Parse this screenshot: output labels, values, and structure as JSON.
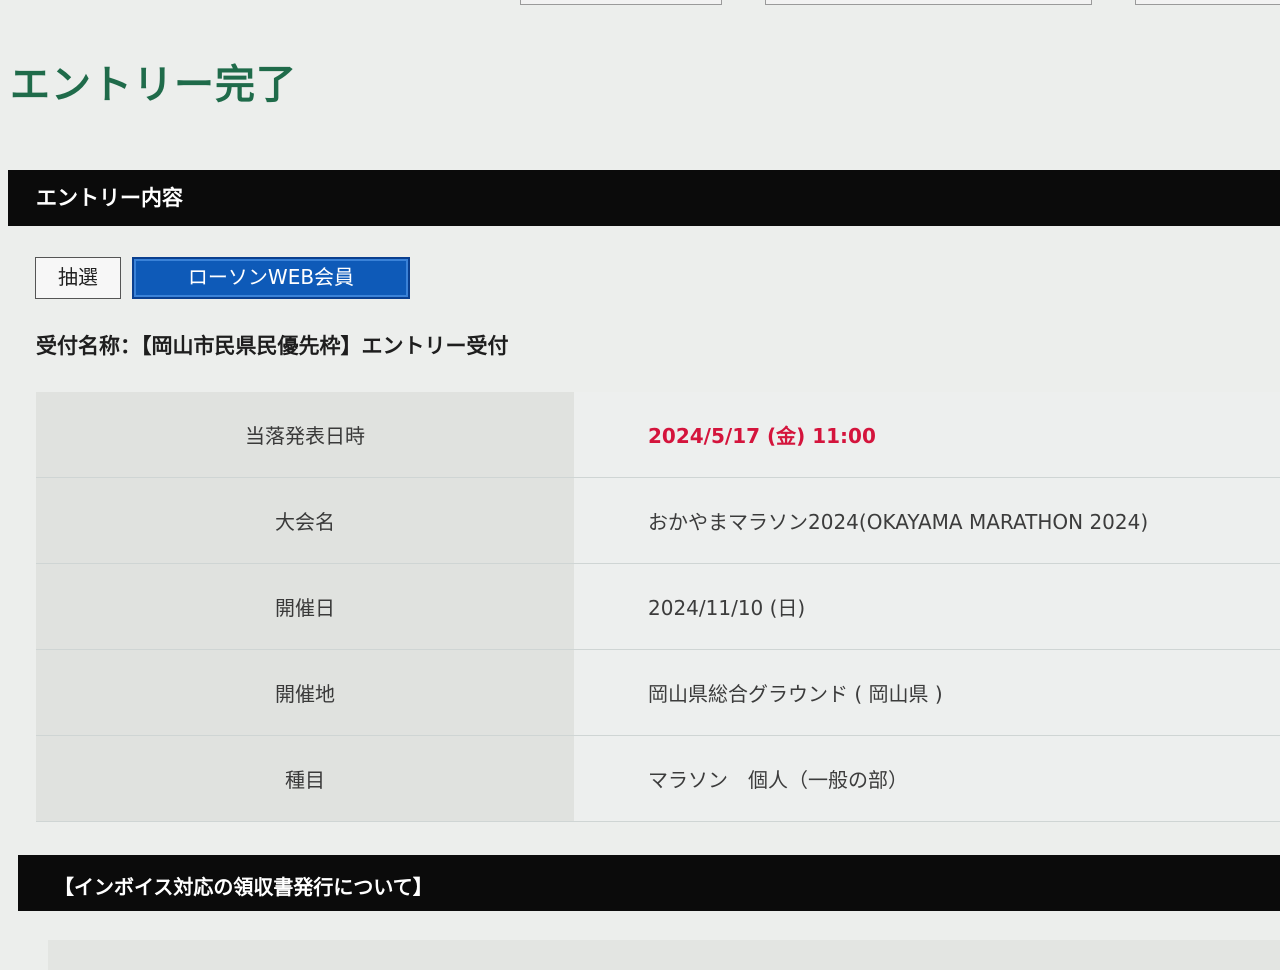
{
  "page": {
    "title": "エントリー完了"
  },
  "entry_section": {
    "heading": "エントリー内容",
    "buttons": {
      "lottery": "抽選",
      "lawson_member": "ローソンWEB会員"
    },
    "receipt_name": "受付名称：【岡山市民県民優先枠】エントリー受付",
    "rows": [
      {
        "label": "当落発表日時",
        "value": "2024/5/17 (金) 11:00"
      },
      {
        "label": "大会名",
        "value": "おかやまマラソン2024(OKAYAMA MARATHON 2024)"
      },
      {
        "label": "開催日",
        "value": "2024/11/10 (日)"
      },
      {
        "label": "開催地",
        "value": "岡山県総合グラウンド ( 岡山県 )"
      },
      {
        "label": "種目",
        "value": "マラソン　個人（一般の部）"
      }
    ]
  },
  "invoice_section": {
    "heading": "【インボイス対応の領収書発行について】"
  },
  "colors": {
    "title_green": "#1f6b4a",
    "section_bar": "#0b0b0b",
    "active_button": "#0e5ab8",
    "highlight_red": "#d4143c"
  }
}
